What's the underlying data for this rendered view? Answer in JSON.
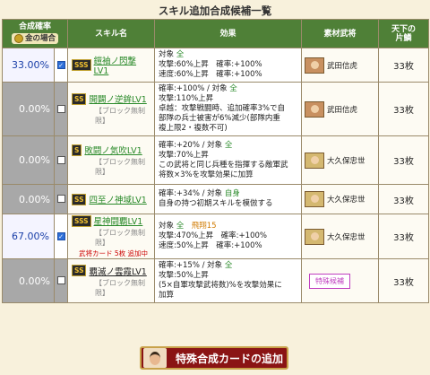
{
  "title": "スキル追加合成候補一覧",
  "headers": {
    "rate": "合成確率",
    "gold": "金の場合",
    "skill": "スキル名",
    "effect": "効果",
    "material": "素材武将",
    "count_l1": "天下の",
    "count_l2": "片鱗"
  },
  "rows": [
    {
      "rate": "33.00%",
      "checked": true,
      "rank": "SSS",
      "name": "鎧袖ノ閃撃LV1",
      "note": "",
      "effect": [
        [
          "対象 ",
          "全",
          ""
        ],
        [
          "攻撃:60%上昇　確率:+100%",
          "",
          ""
        ],
        [
          "速度:60%上昇　確率:+100%",
          "",
          ""
        ]
      ],
      "material": "武田信虎",
      "count": "33枚"
    },
    {
      "rate": "0.00%",
      "checked": false,
      "rank": "SS",
      "name": "開闢ノ逆鉾LV1",
      "note": "【ブロック無制限】",
      "effect": [
        [
          "確率:+100% / 対象 ",
          "全",
          ""
        ],
        [
          "攻撃:110%上昇",
          "",
          ""
        ],
        [
          "卓越：攻撃戦闘時、追加確率3%で自",
          "",
          ""
        ],
        [
          "部隊の兵士被害が6%減少(部隊内重",
          "",
          ""
        ],
        [
          "複上限2・複数不可)",
          "",
          ""
        ]
      ],
      "material": "武田信虎",
      "count": "33枚"
    },
    {
      "rate": "0.00%",
      "checked": false,
      "rank": "S",
      "name": "敗闘ノ気吹LV1",
      "note": "【ブロック無制限】",
      "effect": [
        [
          "確率:+20% / 対象 ",
          "全",
          ""
        ],
        [
          "攻撃:70%上昇",
          "",
          ""
        ],
        [
          "この武将と同じ兵種を指揮する敵軍武",
          "",
          ""
        ],
        [
          "将数×3%を攻撃効果に加算",
          "",
          ""
        ]
      ],
      "material": "大久保忠世",
      "count": "33枚"
    },
    {
      "rate": "0.00%",
      "checked": false,
      "rank": "SS",
      "name": "四至ノ神域LV1",
      "note": "",
      "effect": [
        [
          "確率:+34% / 対象 ",
          "自身",
          ""
        ],
        [
          "自身の持つ初期スキルを模倣する",
          "",
          ""
        ]
      ],
      "material": "大久保忠世",
      "count": "33枚"
    },
    {
      "rate": "67.00%",
      "checked": true,
      "rank": "SSS",
      "name": "星神闘覇LV1",
      "note": "【ブロック無制限】",
      "note2": "武将カード 5枚 追加中",
      "effect": [
        [
          "対象 ",
          "全",
          "　飛翔15"
        ],
        [
          "攻撃:470%上昇　確率:+100%",
          "",
          ""
        ],
        [
          "速度:50%上昇　確率:+100%",
          "",
          ""
        ]
      ],
      "material": "大久保忠世",
      "count": "33枚"
    },
    {
      "rate": "0.00%",
      "checked": false,
      "rank": "SS",
      "name": "覇滅ノ雲霞LV1",
      "note": "【ブロック無制限】",
      "effect": [
        [
          "確率:+15% / 対象 ",
          "全",
          ""
        ],
        [
          "攻撃:50%上昇",
          "",
          ""
        ],
        [
          "(5×自軍攻撃武将数)%を攻撃効果に",
          "",
          ""
        ],
        [
          "加算",
          "",
          ""
        ]
      ],
      "material": "特殊候補",
      "count": "33枚"
    }
  ],
  "button": "特殊合成カードの追加"
}
